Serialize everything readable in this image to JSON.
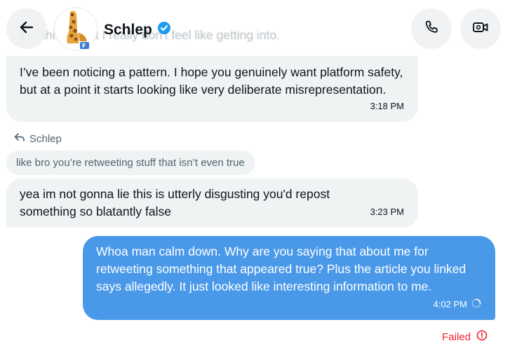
{
  "header": {
    "contact_name": "Schlep",
    "verified": true,
    "ghost_text": "s  er things that I really don't feel like getting into.",
    "icons": [
      "back-arrow-icon",
      "verified-badge-icon",
      "phone-icon",
      "video-icon"
    ]
  },
  "messages": [
    {
      "from": "them",
      "text": "I’ve been noticing a pattern. I hope you genuinely want platform safety, but at a point it starts looking like very deliberate misrepresentation.",
      "time": "3:18 PM"
    },
    {
      "from": "them",
      "reply_to_name": "Schlep",
      "quoted_text": "like bro you’re retweeting stuff that isn’t even true",
      "text": "yea im not gonna lie this is utterly disgusting you'd repost something so blatantly false",
      "time": "3:23 PM"
    },
    {
      "from": "me",
      "text": "Whoa man calm down. Why are you saying that about me for retweeting something that appeared true? Plus the article you linked says allegedly. It just looked like interesting information to me.",
      "time": "4:02 PM",
      "status": "Failed"
    }
  ],
  "colors": {
    "incoming_bubble": "#eff3f4",
    "outgoing_bubble": "#4a99e9",
    "verified": "#1d9bf0",
    "failed": "#f4212e"
  }
}
